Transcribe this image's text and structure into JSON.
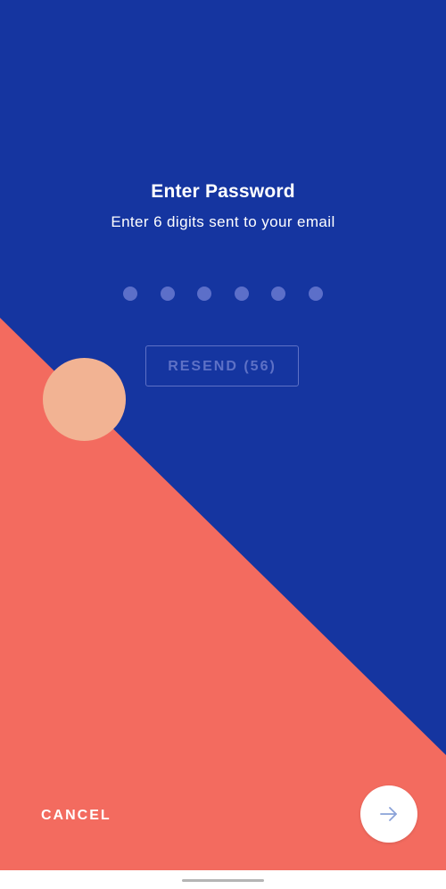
{
  "colors": {
    "primary_blue": "#1535a0",
    "coral": "#f36b5f",
    "peach": "#f2b393",
    "muted_blue": "#5e71c6",
    "white": "#ffffff"
  },
  "header": {
    "title": "Enter Password",
    "subtitle": "Enter 6 digits sent to your email"
  },
  "pin": {
    "length": 6,
    "entered": 0
  },
  "resend": {
    "label": "RESEND",
    "countdown": "56",
    "enabled": false
  },
  "footer": {
    "cancel_label": "CANCEL",
    "next_icon": "arrow-right-icon"
  },
  "nav": {
    "home_indicator": "home-indicator"
  }
}
